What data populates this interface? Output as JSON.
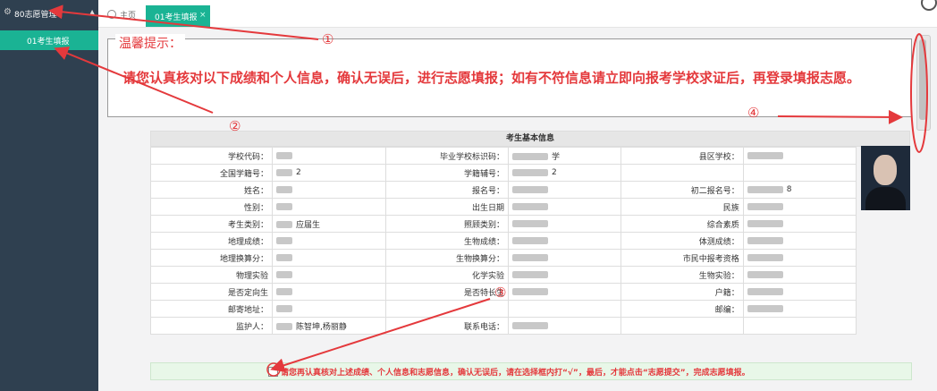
{
  "sidebar": {
    "header_title": "80志愿管理",
    "header_icon": "gear-icon",
    "items": [
      {
        "label": "01考生填报"
      }
    ]
  },
  "tabs": {
    "home_label": "主页",
    "active_label": "01考生填报",
    "close_symbol": "×"
  },
  "notice": {
    "legend": "温馨提示：",
    "message": "请您认真核对以下成绩和个人信息，确认无误后，进行志愿填报；如有不符信息请立即向报考学校求证后，再登录填报志愿。"
  },
  "info_table": {
    "title": "考生基本信息",
    "rows": [
      [
        {
          "label": "学校代码：",
          "value": ""
        },
        {
          "label": "毕业学校标识码：",
          "value": "学"
        },
        {
          "label": "县区学校：",
          "value": ""
        }
      ],
      [
        {
          "label": "全国学籍号：",
          "value": "2"
        },
        {
          "label": "学籍辅号：",
          "value": "2"
        },
        {
          "label": "",
          "value": ""
        }
      ],
      [
        {
          "label": "姓名：",
          "value": ""
        },
        {
          "label": "报名号：",
          "value": ""
        },
        {
          "label": "初二报名号：",
          "value": "8"
        }
      ],
      [
        {
          "label": "性别：",
          "value": ""
        },
        {
          "label": "出生日期",
          "value": ""
        },
        {
          "label": "民族",
          "value": ""
        }
      ],
      [
        {
          "label": "考生类别：",
          "value": "应届生"
        },
        {
          "label": "照顾类别：",
          "value": ""
        },
        {
          "label": "综合素质",
          "value": ""
        }
      ],
      [
        {
          "label": "地理成绩：",
          "value": ""
        },
        {
          "label": "生物成绩：",
          "value": ""
        },
        {
          "label": "体测成绩：",
          "value": ""
        }
      ],
      [
        {
          "label": "地理换算分：",
          "value": ""
        },
        {
          "label": "生物换算分：",
          "value": ""
        },
        {
          "label": "市民中报考资格",
          "value": ""
        }
      ],
      [
        {
          "label": "物理实验",
          "value": ""
        },
        {
          "label": "化学实验",
          "value": ""
        },
        {
          "label": "生物实验：",
          "value": ""
        }
      ],
      [
        {
          "label": "是否定向生",
          "value": ""
        },
        {
          "label": "是否特长生",
          "value": ""
        },
        {
          "label": "户籍：",
          "value": ""
        }
      ],
      [
        {
          "label": "邮寄地址：",
          "value": ""
        },
        {
          "label": "",
          "value": ""
        },
        {
          "label": "邮编：",
          "value": ""
        }
      ],
      [
        {
          "label": "监护人：",
          "value": "陈智坤,杨丽静"
        },
        {
          "label": "联系电话：",
          "value": ""
        },
        {
          "label": "",
          "value": ""
        }
      ]
    ]
  },
  "confirm": {
    "text": "请您再认真核对上述成绩、个人信息和志愿信息，确认无误后，请在选择框内打“√”，最后，才能点击“志愿提交”，完成志愿填报。"
  },
  "annotations": {
    "a1": "①",
    "a2": "②",
    "a3": "③",
    "a4": "④"
  },
  "colors": {
    "sidebar": "#2f4050",
    "accent": "#1ab394",
    "alert": "#e4393c"
  }
}
